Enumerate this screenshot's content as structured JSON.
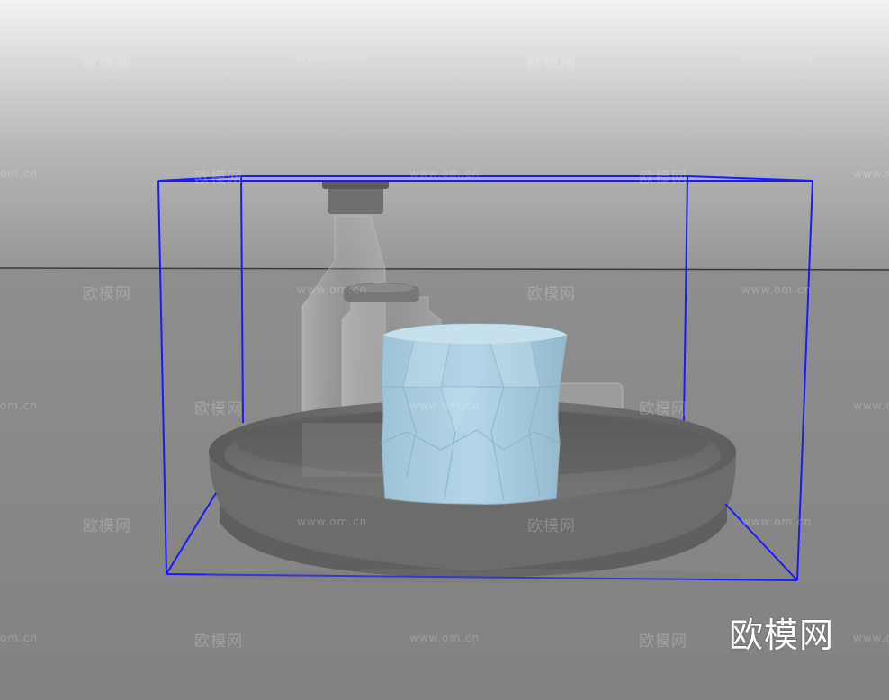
{
  "viewport": {
    "label": "3D model viewport preview",
    "background_top_color": "#f2f2f2",
    "floor_color": "#8b8b8b",
    "selection_box_color": "#1a1aff",
    "cup_color": "#a9cde0",
    "tray_color": "#6e6e6e"
  },
  "objects": {
    "tray": "tray-object",
    "cup": "faceted-cup-object",
    "bottle": "glass-bottle-object",
    "small_bottle": "glass-jar-object",
    "selection_box": "selection-bounding-box"
  },
  "watermark": {
    "cn_text": "欧模网",
    "url_text": "www.om.cn",
    "url_text_partial": "om.cn"
  },
  "logo": {
    "text": "欧模网"
  }
}
